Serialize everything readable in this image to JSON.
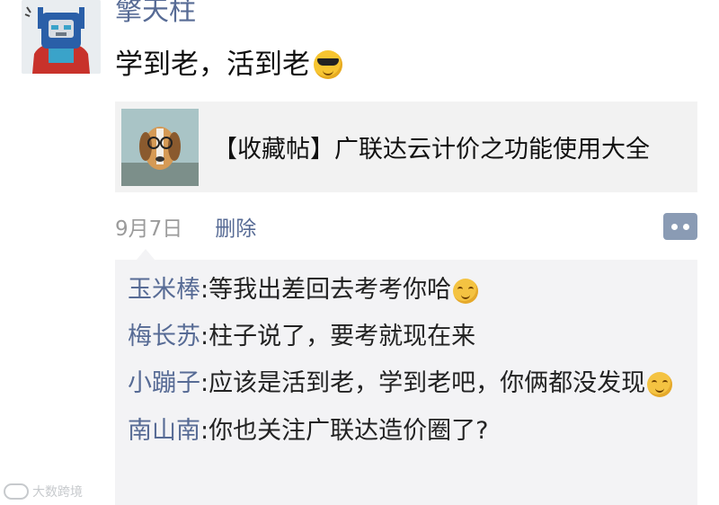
{
  "post": {
    "author": "擎天柱",
    "text": "学到老，活到老",
    "emoji": "sunglasses-emoji"
  },
  "link_card": {
    "title": "【收藏帖】广联达云计价之功能使用大全",
    "thumbnail": "dog-with-glasses-image"
  },
  "meta": {
    "date": "9月7日",
    "delete_label": "删除"
  },
  "comments": [
    {
      "name": "玉米棒",
      "separator": ":",
      "text": "等我出差回去考考你哈"
    },
    {
      "name": "梅长苏",
      "separator": ":",
      "text": "柱子说了，要考就现在来"
    },
    {
      "name": "小蹦子",
      "separator": ":",
      "text": "应该是活到老，学到老吧，你俩都没发现"
    },
    {
      "name": "南山南",
      "separator": ":",
      "text": "你也关注广联达造价圈了?"
    }
  ],
  "watermark": {
    "text": "大数跨境"
  },
  "colors": {
    "link_blue": "#576b95",
    "comment_bg": "#f3f3f5",
    "card_bg": "#f2f2f2",
    "comment_button": "#8a9bb4"
  }
}
